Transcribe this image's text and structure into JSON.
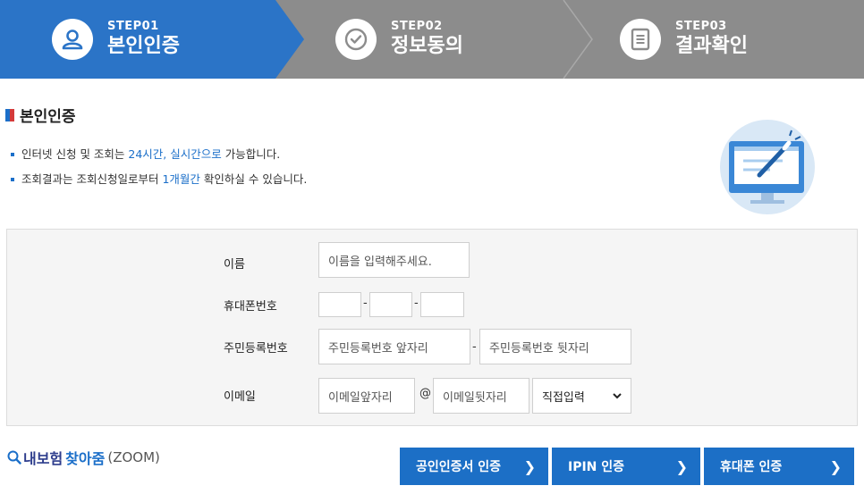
{
  "steps": [
    {
      "label": "STEP01",
      "title": "본인인증",
      "icon": "person-icon",
      "active": true
    },
    {
      "label": "STEP02",
      "title": "정보동의",
      "icon": "check-circle-icon",
      "active": false
    },
    {
      "label": "STEP03",
      "title": "결과확인",
      "icon": "document-icon",
      "active": false
    }
  ],
  "colors": {
    "active_step": "#2b74c7",
    "inactive_step": "#8c8c8c",
    "accent": "#1b6fc9",
    "button": "#1c6fc6"
  },
  "section": {
    "title": "본인인증"
  },
  "notes": {
    "line1_pre": "인터넷 신청 및 조회는 ",
    "line1_hl": "24시간, 실시간으로",
    "line1_post": " 가능합니다.",
    "line2_pre": "조회결과는 조회신청일로부터 ",
    "line2_hl": "1개월간",
    "line2_post": " 확인하실 수 있습니다."
  },
  "form": {
    "name_label": "이름",
    "name_placeholder": "이름을 입력해주세요.",
    "phone_label": "휴대폰번호",
    "phone_sep": "-",
    "rrn_label": "주민등록번호",
    "rrn_front_placeholder": "주민등록번호 앞자리",
    "rrn_sep": "-",
    "rrn_back_placeholder": "주민등록번호 뒷자리",
    "email_label": "이메일",
    "email_front_placeholder": "이메일앞자리",
    "email_at": "@",
    "email_domain_placeholder": "이메일뒷자리",
    "email_select": "직접입력"
  },
  "brand": {
    "part1": "내보험",
    "part2": "찾아줌",
    "part3": "(ZOOM)"
  },
  "buttons": {
    "cert": "공인인증서 인증",
    "ipin": "IPIN 인증",
    "phone": "휴대폰 인증",
    "arrow": "❯"
  }
}
